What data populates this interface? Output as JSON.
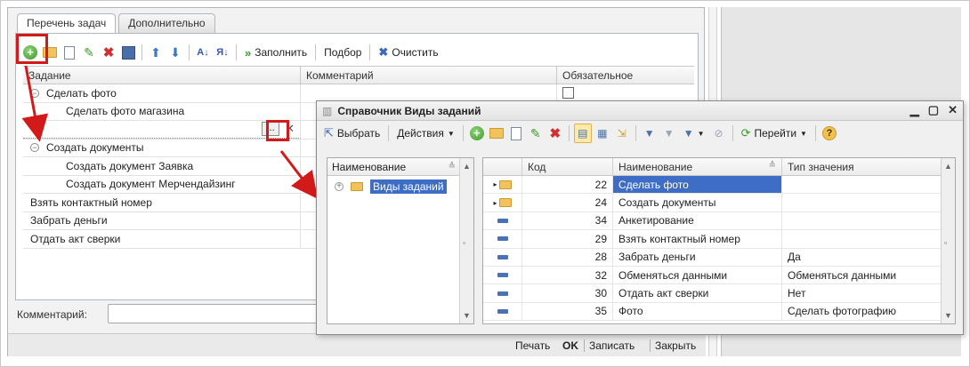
{
  "form": {
    "tabs": [
      "Перечень задач",
      "Дополнительно"
    ],
    "toolbar": {
      "fill": "Заполнить",
      "select": "Подбор",
      "clear": "Очистить"
    },
    "columns": [
      "Задание",
      "Комментарий",
      "Обязательное"
    ],
    "rows": [
      {
        "name": "Сделать фото",
        "level": 0,
        "group": true
      },
      {
        "name": "Сделать фото магазина",
        "level": 1
      },
      {
        "name": "",
        "level": 1,
        "editing": true
      },
      {
        "name": "Создать документы",
        "level": 0,
        "group": true
      },
      {
        "name": "Создать документ Заявка",
        "level": 1
      },
      {
        "name": "Создать документ Мерчендайзинг",
        "level": 1
      },
      {
        "name": "Взять контактный номер",
        "level": 0
      },
      {
        "name": "Забрать деньги",
        "level": 0
      },
      {
        "name": "Отдать акт сверки",
        "level": 0
      }
    ],
    "comment_label": "Комментарий:",
    "comment_value": "",
    "bottom": {
      "print": "Печать",
      "ok": "OK",
      "write": "Записать",
      "close": "Закрыть"
    },
    "ellipsis": "...",
    "clear_glyph": "✕"
  },
  "dialog": {
    "title": "Справочник Виды заданий",
    "toolbar": {
      "choose": "Выбрать",
      "actions": "Действия",
      "goto": "Перейти"
    },
    "tree_header": "Наименование",
    "tree_root": "Виды заданий",
    "columns": [
      "Код",
      "Наименование",
      "Тип значения"
    ],
    "rows": [
      {
        "code": "22",
        "name": "Сделать фото",
        "type": "",
        "kind": "folder",
        "selected": true
      },
      {
        "code": "24",
        "name": "Создать документы",
        "type": "",
        "kind": "folder"
      },
      {
        "code": "34",
        "name": "Анкетирование",
        "type": "",
        "kind": "item"
      },
      {
        "code": "29",
        "name": "Взять контактный номер",
        "type": "",
        "kind": "item"
      },
      {
        "code": "28",
        "name": "Забрать деньги",
        "type": "Да",
        "kind": "item"
      },
      {
        "code": "32",
        "name": "Обменяться данными",
        "type": "Обменяться данными",
        "kind": "item"
      },
      {
        "code": "30",
        "name": "Отдать акт сверки",
        "type": "Нет",
        "kind": "item"
      },
      {
        "code": "35",
        "name": "Фото",
        "type": "Сделать фотографию",
        "kind": "item"
      }
    ]
  },
  "colors": {
    "highlight": "#d21a1a",
    "selection": "#3d6dc4"
  }
}
